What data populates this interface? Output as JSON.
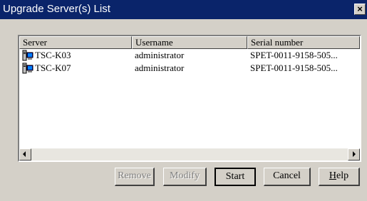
{
  "window": {
    "title": "Upgrade Server(s) List",
    "close_label": "×"
  },
  "list": {
    "columns": [
      "Server",
      "Username",
      "Serial number"
    ],
    "rows": [
      {
        "server": "TSC-K03",
        "username": "administrator",
        "serial": "SPET-0011-9158-505..."
      },
      {
        "server": "TSC-K07",
        "username": "administrator",
        "serial": "SPET-0011-9158-505..."
      }
    ]
  },
  "buttons": {
    "remove": {
      "label": "Remove",
      "enabled": false
    },
    "modify": {
      "label": "Modify",
      "enabled": false
    },
    "start": {
      "label": "Start",
      "enabled": true
    },
    "cancel": {
      "label": "Cancel",
      "enabled": true
    },
    "help": {
      "label_prefix": "",
      "label_underlined": "H",
      "label_suffix": "elp",
      "enabled": true
    }
  },
  "icons": {
    "server": "server-computer-icon",
    "close": "close-icon",
    "scroll_left": "left-arrow-icon",
    "scroll_right": "right-arrow-icon"
  },
  "colors": {
    "titlebar": "#0a246a",
    "face": "#d4d0c8",
    "disabled_text": "#808080"
  }
}
